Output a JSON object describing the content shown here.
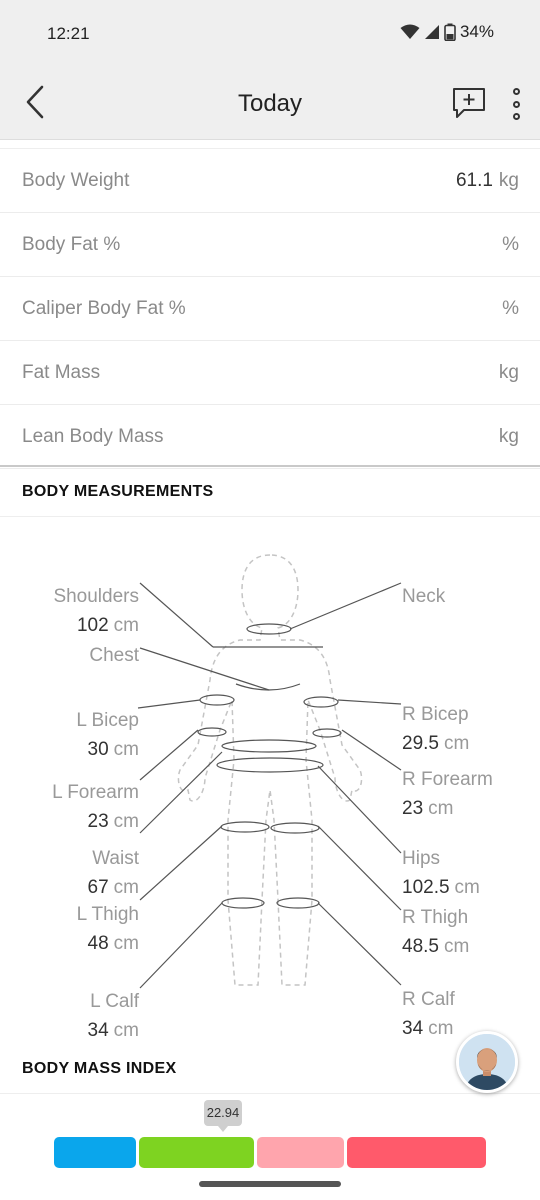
{
  "status": {
    "time": "12:21",
    "battery": "34%"
  },
  "appbar": {
    "title": "Today"
  },
  "stats": [
    {
      "label": "Body Weight",
      "value": "61.1",
      "unit": "kg"
    },
    {
      "label": "Body Fat %",
      "value": "",
      "unit": "%"
    },
    {
      "label": "Caliper Body Fat %",
      "value": "",
      "unit": "%"
    },
    {
      "label": "Fat Mass",
      "value": "",
      "unit": "kg"
    },
    {
      "label": "Lean Body Mass",
      "value": "",
      "unit": "kg"
    }
  ],
  "measurements": {
    "header": "BODY MEASUREMENTS",
    "shoulders": {
      "label": "Shoulders",
      "value": "102",
      "unit": "cm"
    },
    "neck": {
      "label": "Neck",
      "value": "",
      "unit": ""
    },
    "chest": {
      "label": "Chest",
      "value": "",
      "unit": ""
    },
    "l_bicep": {
      "label": "L Bicep",
      "value": "30",
      "unit": "cm"
    },
    "r_bicep": {
      "label": "R Bicep",
      "value": "29.5",
      "unit": "cm"
    },
    "l_forearm": {
      "label": "L Forearm",
      "value": "23",
      "unit": "cm"
    },
    "r_forearm": {
      "label": "R Forearm",
      "value": "23",
      "unit": "cm"
    },
    "waist": {
      "label": "Waist",
      "value": "67",
      "unit": "cm"
    },
    "hips": {
      "label": "Hips",
      "value": "102.5",
      "unit": "cm"
    },
    "l_thigh": {
      "label": "L Thigh",
      "value": "48",
      "unit": "cm"
    },
    "r_thigh": {
      "label": "R Thigh",
      "value": "48.5",
      "unit": "cm"
    },
    "l_calf": {
      "label": "L Calf",
      "value": "34",
      "unit": "cm"
    },
    "r_calf": {
      "label": "R Calf",
      "value": "34",
      "unit": "cm"
    }
  },
  "bmi": {
    "header": "BODY MASS INDEX",
    "value": "22.94",
    "colors": {
      "underweight": "#0aa6ec",
      "normal": "#7ed321",
      "overweight": "#ffa5ad",
      "obese": "#ff5a6b"
    }
  },
  "icons": {
    "back": "back-arrow-icon",
    "chat": "add-comment-icon",
    "more": "more-vertical-icon",
    "wifi": "wifi-icon",
    "signal": "signal-icon",
    "battery": "battery-icon"
  }
}
